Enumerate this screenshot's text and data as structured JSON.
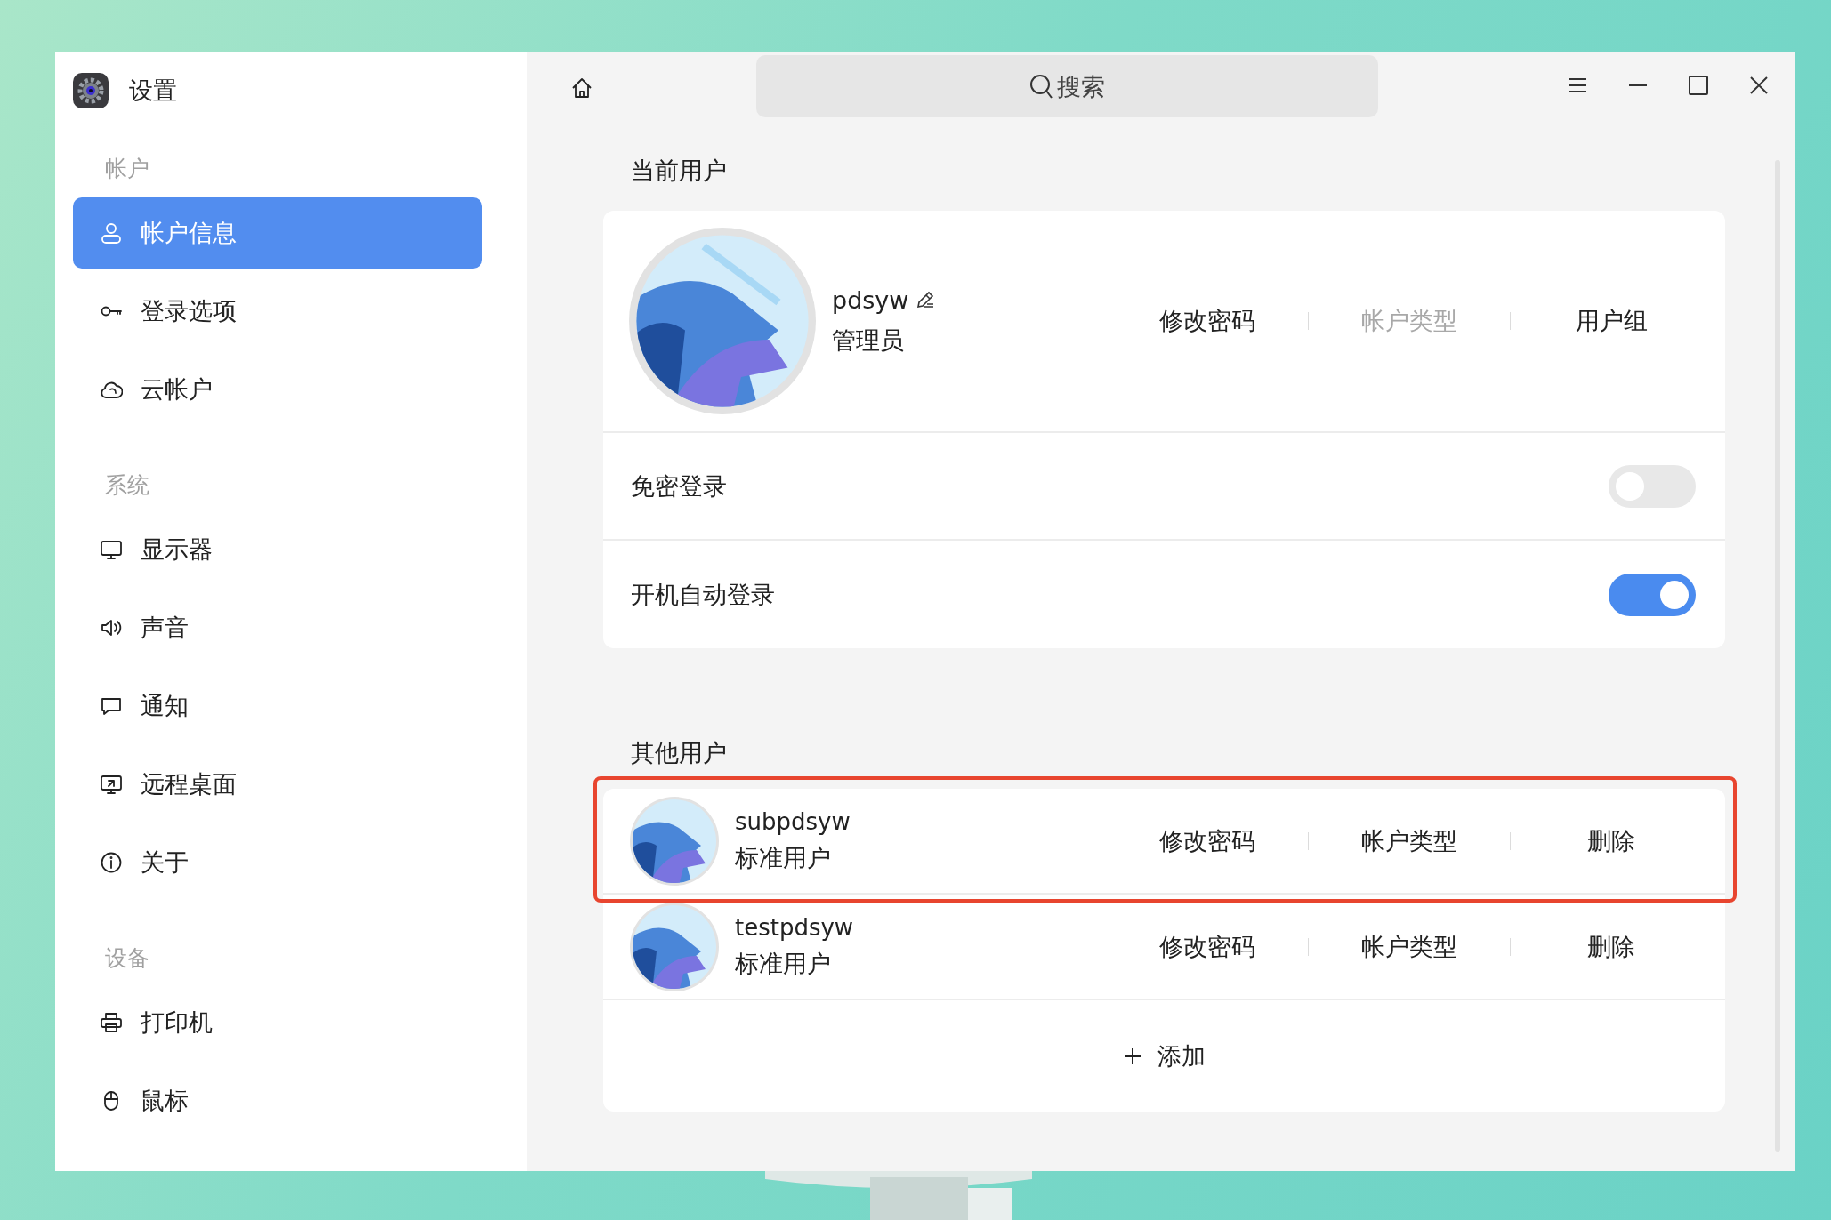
{
  "window": {
    "title": "设置"
  },
  "sidebar": {
    "sections": [
      {
        "header": "帐户",
        "items": [
          {
            "label": "帐户信息",
            "kind": "user",
            "selected": true
          },
          {
            "label": "登录选项",
            "kind": "key",
            "selected": false
          },
          {
            "label": "云帐户",
            "kind": "cloud",
            "selected": false
          }
        ]
      },
      {
        "header": "系统",
        "items": [
          {
            "label": "显示器",
            "kind": "monitor",
            "selected": false
          },
          {
            "label": "声音",
            "kind": "speaker",
            "selected": false
          },
          {
            "label": "通知",
            "kind": "chat",
            "selected": false
          },
          {
            "label": "远程桌面",
            "kind": "remote",
            "selected": false
          },
          {
            "label": "关于",
            "kind": "info",
            "selected": false
          }
        ]
      },
      {
        "header": "设备",
        "items": [
          {
            "label": "打印机",
            "kind": "printer",
            "selected": false
          },
          {
            "label": "鼠标",
            "kind": "mouse",
            "selected": false
          }
        ]
      }
    ]
  },
  "search": {
    "placeholder": "搜索"
  },
  "current_user": {
    "section_title": "当前用户",
    "name": "pdsyw",
    "role": "管理员",
    "actions": [
      {
        "label": "修改密码",
        "disabled": false
      },
      {
        "label": "帐户类型",
        "disabled": true
      },
      {
        "label": "用户组",
        "disabled": false
      }
    ],
    "settings": [
      {
        "label": "免密登录",
        "on": false
      },
      {
        "label": "开机自动登录",
        "on": true
      }
    ]
  },
  "other_users": {
    "section_title": "其他用户",
    "users": [
      {
        "name": "subpdsyw",
        "role": "标准用户",
        "highlighted": true,
        "actions": [
          {
            "label": "修改密码",
            "disabled": false
          },
          {
            "label": "帐户类型",
            "disabled": false
          },
          {
            "label": "删除",
            "disabled": false
          }
        ]
      },
      {
        "name": "testpdsyw",
        "role": "标准用户",
        "highlighted": false,
        "actions": [
          {
            "label": "修改密码",
            "disabled": false
          },
          {
            "label": "帐户类型",
            "disabled": false
          },
          {
            "label": "删除",
            "disabled": false
          }
        ]
      }
    ],
    "add_button": {
      "label": "添加"
    }
  }
}
